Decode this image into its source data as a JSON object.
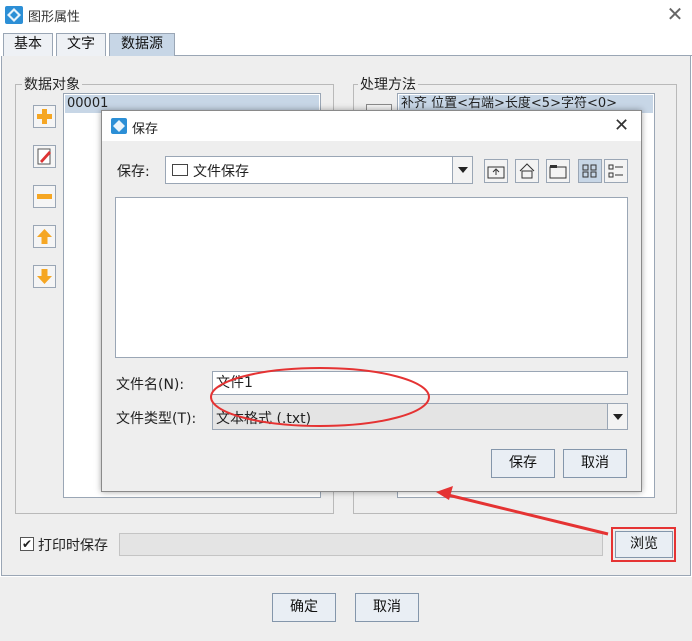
{
  "window": {
    "title": "图形属性",
    "icons": {
      "app": "app-diamond-icon",
      "close": "close-icon"
    }
  },
  "tabs": [
    {
      "label": "基本",
      "active": false
    },
    {
      "label": "文字",
      "active": false
    },
    {
      "label": "数据源",
      "active": true
    }
  ],
  "data_object": {
    "legend": "数据对象",
    "items": [
      "00001"
    ],
    "side_buttons": [
      "add-icon",
      "edit-icon",
      "remove-icon",
      "move-up-icon",
      "move-down-icon"
    ]
  },
  "process_method": {
    "legend": "处理方法",
    "items": [
      "补齐 位置<右端>长度<5>字符<0>"
    ]
  },
  "print_save": {
    "label": "打印时保存",
    "checked": true,
    "path_value": "",
    "browse_label": "浏览"
  },
  "footer": {
    "ok_label": "确定",
    "cancel_label": "取消"
  },
  "save_dialog": {
    "title": "保存",
    "look_in_label": "保存:",
    "look_in_value": "文件保存",
    "toolbar_icons": [
      "up-folder-icon",
      "home-icon",
      "new-folder-icon",
      "list-view-icon",
      "details-view-icon"
    ],
    "filename_label": "文件名(N):",
    "filename_value": "文件1",
    "filetype_label": "文件类型(T):",
    "filetype_value": "文本格式 (.txt)",
    "save_label": "保存",
    "cancel_label": "取消"
  },
  "colors": {
    "annotation": "#e53333",
    "accent": "#2c8fd6",
    "icon_orange": "#f5a623"
  }
}
